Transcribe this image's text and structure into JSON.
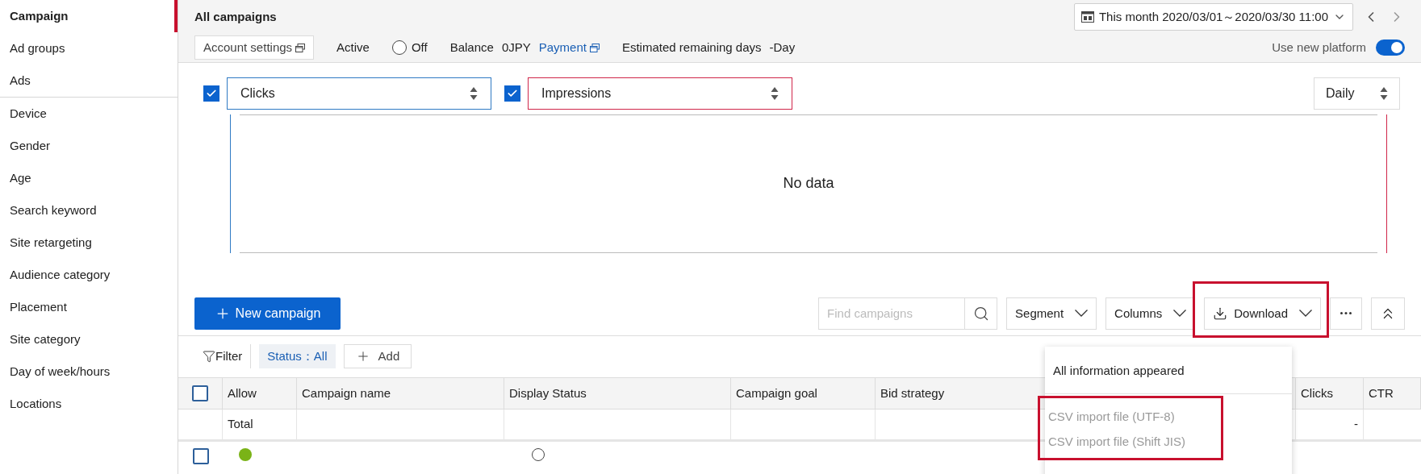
{
  "sidebar": {
    "sections": [
      {
        "items": [
          {
            "label": "Campaign",
            "selected": true
          },
          {
            "label": "Ad groups",
            "selected": false
          },
          {
            "label": "Ads",
            "selected": false
          }
        ]
      },
      {
        "items": [
          {
            "label": "Device",
            "selected": false
          },
          {
            "label": "Gender",
            "selected": false
          },
          {
            "label": "Age",
            "selected": false
          },
          {
            "label": "Search keyword",
            "selected": false
          },
          {
            "label": "Site retargeting",
            "selected": false
          },
          {
            "label": "Audience category",
            "selected": false
          },
          {
            "label": "Placement",
            "selected": false
          },
          {
            "label": "Site category",
            "selected": false
          },
          {
            "label": "Day of week/hours",
            "selected": false
          },
          {
            "label": "Locations",
            "selected": false
          }
        ]
      }
    ]
  },
  "header": {
    "title": "All campaigns",
    "date_range": "This month 2020/03/01～2020/03/30 11:00",
    "account_settings": "Account settings",
    "active_label": "Active",
    "off_option": {
      "label": "Off",
      "selected": false
    },
    "balance_label": "Balance",
    "balance_value": "0JPY",
    "payment_link": "Payment",
    "remaining_label": "Estimated remaining days",
    "remaining_value": "-Day",
    "new_platform": {
      "label": "Use new platform",
      "on": true
    }
  },
  "chart": {
    "metrics": [
      {
        "label": "Clicks",
        "checked": true,
        "color": "#2f7ac4"
      },
      {
        "label": "Impressions",
        "checked": true,
        "color": "#d0264a"
      }
    ],
    "interval": "Daily",
    "empty_message": "No data"
  },
  "toolbar": {
    "new_button": "New campaign",
    "search_placeholder": "Find campaigns",
    "buttons": [
      {
        "label": "Segment",
        "kind": "menu",
        "highlighted": false
      },
      {
        "label": "Columns",
        "kind": "menu",
        "highlighted": false
      },
      {
        "label": "Download",
        "kind": "download",
        "highlighted": true
      }
    ]
  },
  "filter": {
    "label": "Filter",
    "chips": [
      "Status：All"
    ],
    "add": "Add"
  },
  "table": {
    "select_all_checked": false,
    "columns": [
      "Allow",
      "Campaign name",
      "Display Status",
      "Campaign goal",
      "Bid strategy",
      "Clicks",
      "CTR"
    ],
    "rows": [
      {
        "kind": "total",
        "label": "Total",
        "clicks": "-"
      },
      {
        "kind": "campaign",
        "checked": false,
        "color": "#7ab317",
        "selected": false
      }
    ]
  },
  "download_menu": {
    "items": [
      {
        "label": "All information appeared",
        "disabled": false,
        "highlighted": false
      },
      {
        "label": "CSV import file (UTF-8)",
        "disabled": true,
        "highlighted": true
      },
      {
        "label": "CSV import file (Shift JIS)",
        "disabled": true,
        "highlighted": true
      }
    ]
  }
}
